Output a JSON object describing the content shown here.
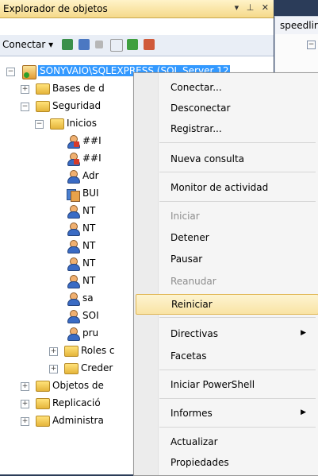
{
  "explorer": {
    "title": "Explorador de objetos",
    "title_controls": [
      "▾",
      "⊥",
      "✕"
    ],
    "toolbar": {
      "connect_label": "Conectar ▾"
    }
  },
  "doc_tab": {
    "label": "speedlir"
  },
  "tree": {
    "server": "SONYVAIO\\SQLEXPRESS (SQL Server 12",
    "bases": "Bases de d",
    "seguridad": "Seguridad",
    "inicios": "Inicios",
    "logins": [
      "##I",
      "##I",
      "Adr",
      "BUI",
      "NT",
      "NT",
      "NT",
      "NT",
      "NT",
      "sa",
      "SOI",
      "pru"
    ],
    "roles": "Roles c",
    "credenciales": "Creder",
    "objetos": "Objetos de",
    "replicacion": "Replicació",
    "administracion": "Administra"
  },
  "context_menu": {
    "items": [
      "Conectar...",
      "Desconectar",
      "Registrar...",
      "Nueva consulta",
      "Monitor de actividad",
      "Iniciar",
      "Detener",
      "Pausar",
      "Reanudar",
      "Reiniciar",
      "Directivas",
      "Facetas",
      "Iniciar PowerShell",
      "Informes",
      "Actualizar",
      "Propiedades"
    ]
  }
}
